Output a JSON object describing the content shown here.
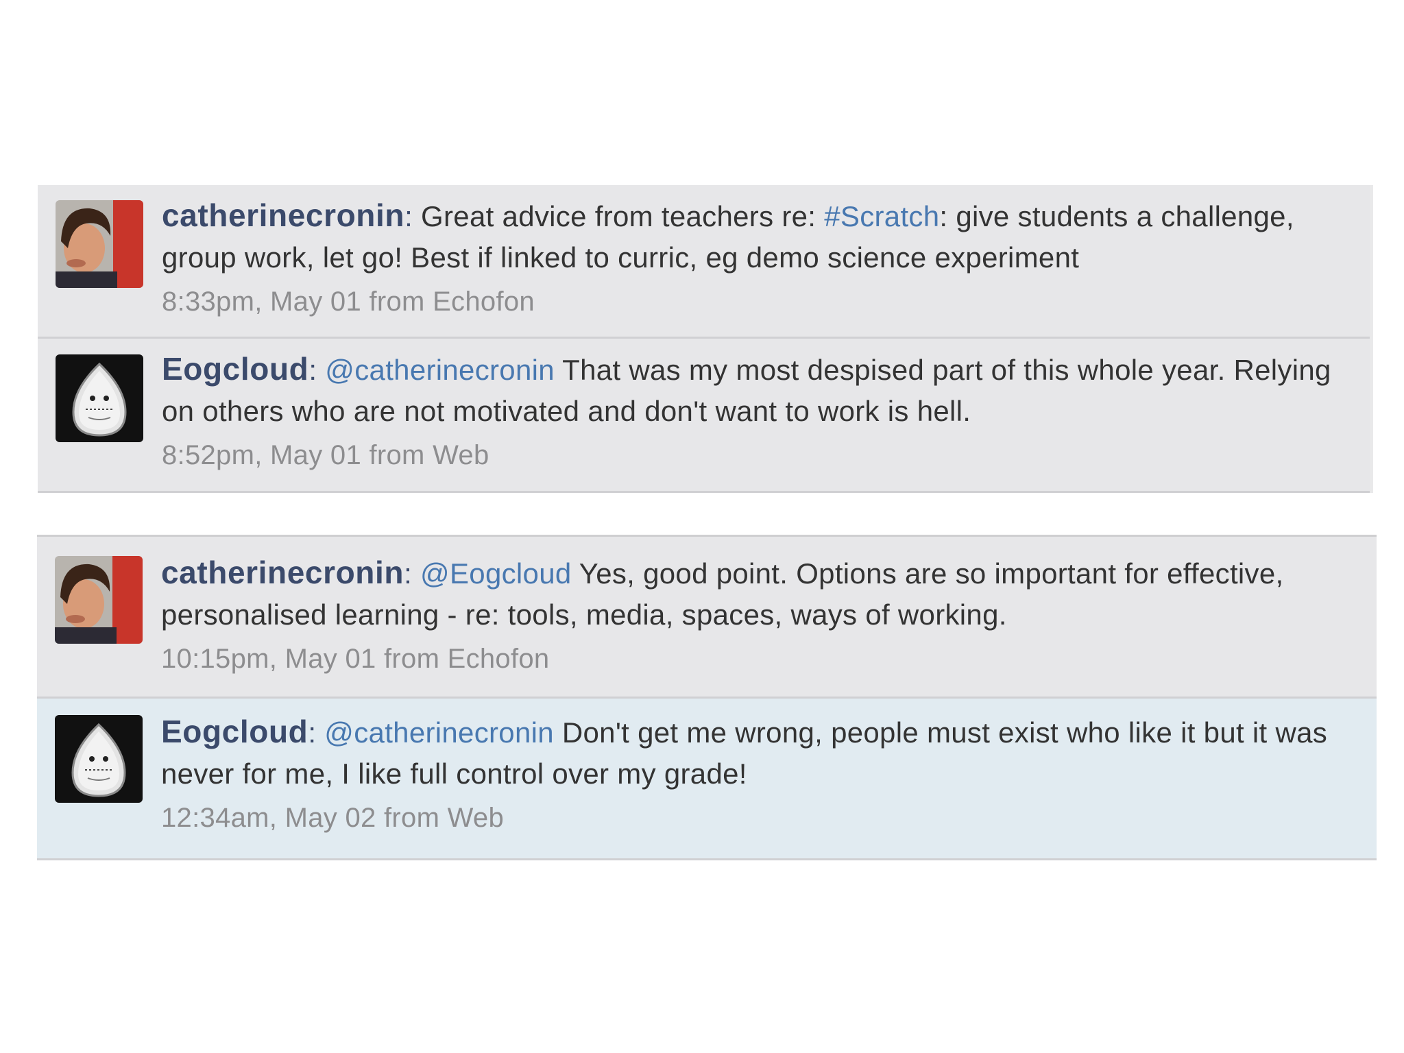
{
  "timeline_top": [
    {
      "username": "catherinecronin",
      "text_before": "",
      "link": "",
      "hashtag": "#Scratch",
      "text_after": ": give students a challenge, group work, let go! Best if linked to curric, eg demo science experiment",
      "pre_hashtag": "Great advice from teachers re: ",
      "time": "8:33pm, May 01",
      "source": "from Echofon",
      "avatar": "woman-portrait-avatar"
    },
    {
      "username": "Eogcloud",
      "mention": "@catherinecronin",
      "text": " That was my most despised part of this whole year. Relying on others who are not motivated and don't want to work is hell.",
      "time": "8:52pm, May 01",
      "source": "from Web",
      "avatar": "egg-character-avatar"
    }
  ],
  "timeline_bottom": [
    {
      "username": "catherinecronin",
      "mention": "@Eogcloud",
      "text": " Yes, good point. Options are so important for effective, personalised learning - re: tools, media, spaces, ways of working.",
      "time": "10:15pm, May 01",
      "source": "from Echofon",
      "avatar": "woman-portrait-avatar"
    },
    {
      "username": "Eogcloud",
      "mention": "@catherinecronin",
      "text": " Don't get me wrong, people must exist who like it but it was never for me, I like full control over my grade!",
      "time": "12:34am, May 02",
      "source": "from Web",
      "avatar": "egg-character-avatar"
    }
  ],
  "colors": {
    "username": "#3b4a6b",
    "link": "#4878b0",
    "meta": "#8d8d8f",
    "tweet_bg": "#e7e7e9",
    "highlight_bg": "#e1ebf1"
  }
}
